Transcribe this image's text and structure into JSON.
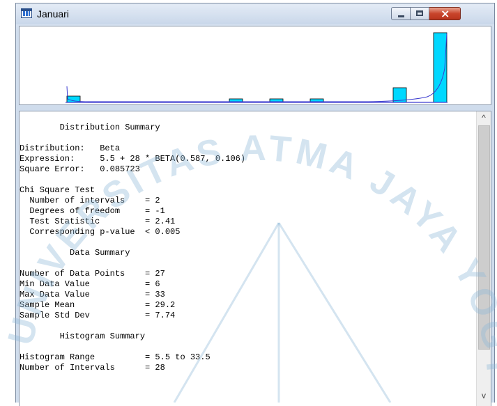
{
  "window": {
    "title": "Januari"
  },
  "histogram": {
    "bar_color": "#00d8ff",
    "curve_color": "#3b3bcf"
  },
  "report": {
    "lines": [
      "        Distribution Summary",
      "",
      "Distribution:   Beta",
      "Expression:     5.5 + 28 * BETA(0.587, 0.106)",
      "Square Error:   0.085723",
      "",
      "Chi Square Test",
      "  Number of intervals    = 2",
      "  Degrees of freedom     = -1",
      "  Test Statistic         = 2.41",
      "  Corresponding p-value  < 0.005",
      "",
      "          Data Summary",
      "",
      "Number of Data Points    = 27",
      "Min Data Value           = 6",
      "Max Data Value           = 33",
      "Sample Mean              = 29.2",
      "Sample Std Dev           = 7.74",
      "",
      "        Histogram Summary",
      "",
      "Histogram Range          = 5.5 to 33.5",
      "Number of Intervals      = 28"
    ]
  },
  "watermark": {
    "text": "UNIVERSITAS ATMA JAYA YOGYAKARTA",
    "color": "#8fb8d8"
  },
  "scrollbar": {
    "up_glyph": "^",
    "down_glyph": "v"
  }
}
